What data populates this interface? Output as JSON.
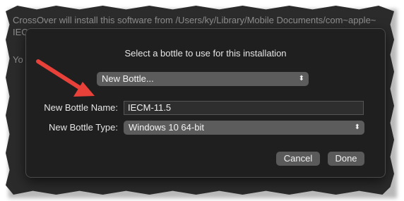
{
  "background_window": {
    "line1": "CrossOver will install this software from /Users/ky/Library/Mobile Documents/com~apple~",
    "line2": "IEC",
    "line3": "Yo"
  },
  "dialog": {
    "title": "Select a bottle to use for this installation",
    "bottle_popup": {
      "selected": "New Bottle...",
      "arrows_icon": "up-down-chevron-icon"
    },
    "name_label": "New Bottle Name:",
    "name_value": "IECM-11.5",
    "type_label": "New Bottle Type:",
    "type_popup": {
      "selected": "Windows 10 64-bit",
      "arrows_icon": "up-down-chevron-icon"
    },
    "cancel_label": "Cancel",
    "done_label": "Done"
  },
  "annotation": {
    "arrow_color": "#e8413a",
    "arrow_icon": "red-arrow"
  },
  "colors": {
    "sheet_bg": "#1f1f1f",
    "control_bg": "#5c5c5c",
    "text": "#e6e6e6"
  }
}
